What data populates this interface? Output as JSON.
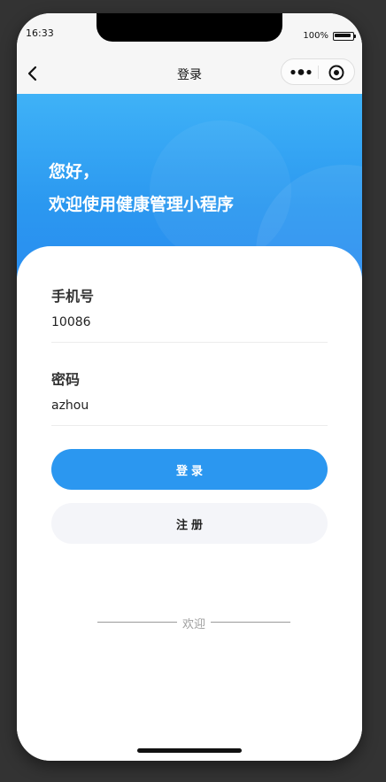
{
  "status_bar": {
    "time": "16:33",
    "battery": "100%"
  },
  "nav": {
    "title": "登录",
    "back_icon": "chevron-left-icon",
    "more_icon": "more-dots-icon",
    "close_icon": "target-circle-icon"
  },
  "hero": {
    "greeting": "您好，",
    "subtitle": "欢迎使用健康管理小程序"
  },
  "form": {
    "phone_label": "手机号",
    "phone_value": "10086",
    "password_label": "密码",
    "password_value": "azhou"
  },
  "buttons": {
    "login": "登录",
    "register": "注册"
  },
  "footer": {
    "welcome": "欢迎"
  },
  "colors": {
    "primary": "#2b97f0",
    "hero_top": "#3fb2f7",
    "secondary_button": "#f4f5f9",
    "background": "#333333"
  }
}
